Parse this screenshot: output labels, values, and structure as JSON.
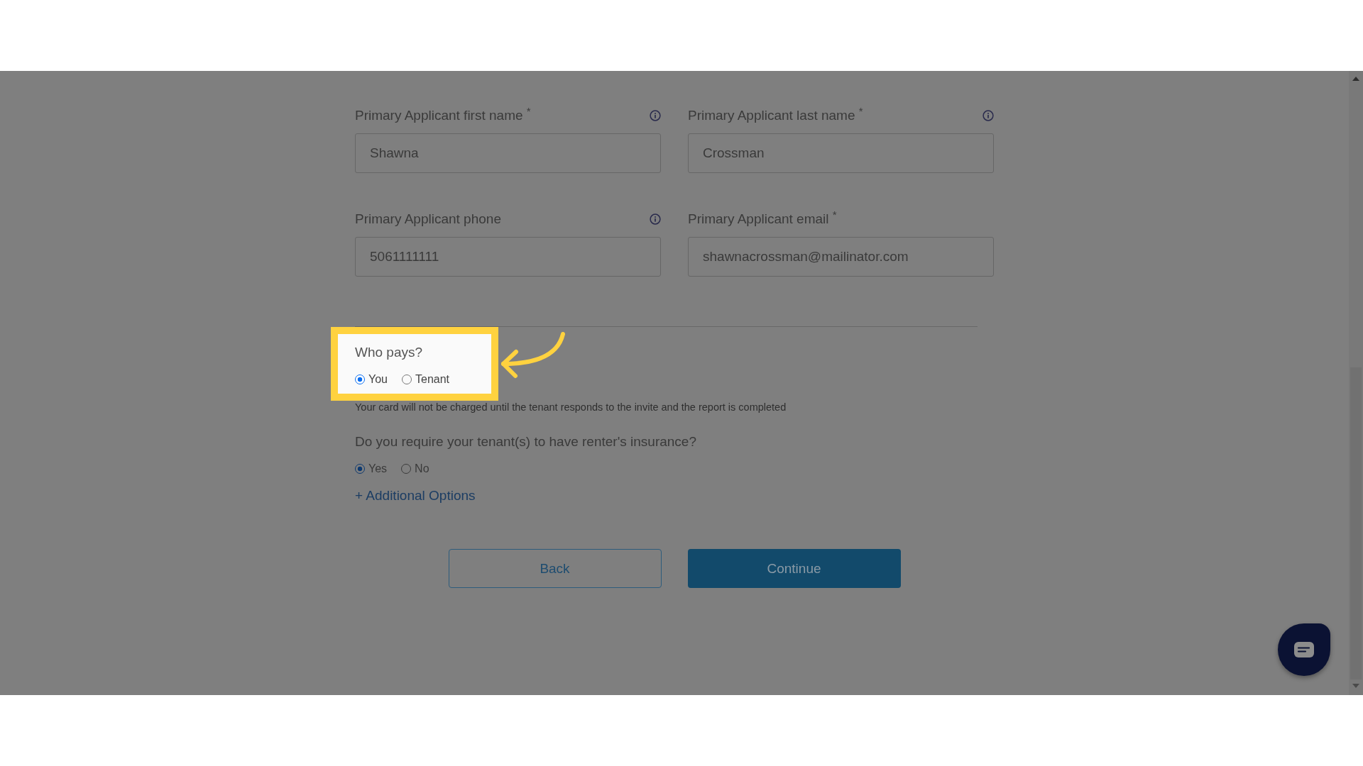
{
  "fields": [
    {
      "label": "Primary Applicant first name $^{*}$",
      "info": true,
      "value": "Shawna"
    },
    {
      "label": "Primary Applicant last name $^{*}$",
      "info": true,
      "value": "Crossman"
    },
    {
      "label": "Primary Applicant phone",
      "info": true,
      "value": "5061111111"
    },
    {
      "label": "Primary Applicant email $^{*}$",
      "info": false,
      "value": "shawnacrossman@mailinator.com"
    }
  ],
  "who_pays": {
    "highlighted": true,
    "question": "Who pays?",
    "options": [
      {
        "label": "You",
        "selected": true
      },
      {
        "label": "Tenant",
        "selected": false
      }
    ]
  },
  "note": "Your card will not be charged until the tenant responds to the invite and the report is completed",
  "insurance": {
    "question": "Do you require your tenant(s) to have renter's insurance?",
    "options": [
      {
        "label": "Yes",
        "selected": true
      },
      {
        "label": "No",
        "selected": false
      }
    ]
  },
  "additional_options_link": "+ Additional Options",
  "buttons": [
    {
      "label": "Back",
      "kind": "secondary"
    },
    {
      "label": "Continue",
      "kind": "primary"
    }
  ]
}
